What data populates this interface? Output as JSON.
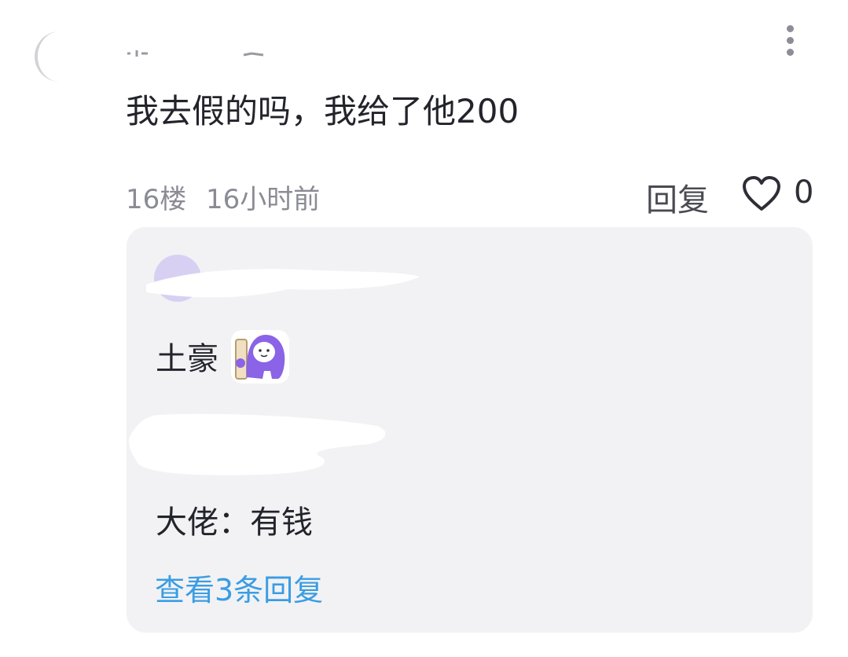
{
  "comment": {
    "text": "我去假的吗，我给了他200",
    "floor": "16楼",
    "time": "16小时前",
    "reply_label": "回复",
    "like_count": "0"
  },
  "replies": [
    {
      "text": "土豪",
      "sticker_icon": "purple-mascot-sticker"
    },
    {
      "text": "大佬：有钱"
    }
  ],
  "view_more_label": "查看3条回复",
  "colors": {
    "card_bg": "#f2f2f4",
    "link": "#3a9de3",
    "meta": "#8b8b95",
    "sticker_purple": "#8a63e6"
  }
}
